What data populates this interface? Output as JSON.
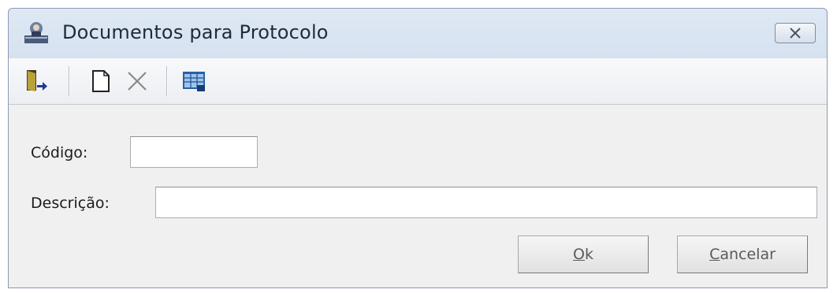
{
  "window": {
    "title": "Documentos para Protocolo",
    "close_icon": "close-icon"
  },
  "toolbar": {
    "items": [
      {
        "name": "exit",
        "icon": "exit-door-icon"
      },
      {
        "name": "new",
        "icon": "new-document-icon"
      },
      {
        "name": "delete",
        "icon": "delete-x-icon"
      },
      {
        "name": "view",
        "icon": "grid-view-icon"
      }
    ]
  },
  "form": {
    "codigo_label": "Código:",
    "codigo_value": "",
    "descricao_label": "Descrição:",
    "descricao_value": ""
  },
  "buttons": {
    "ok_mnemonic": "O",
    "ok_rest": "k",
    "cancel_mnemonic": "C",
    "cancel_rest": "ancelar"
  },
  "colors": {
    "title_bar": "#c9d8ea",
    "body": "#f0f0f0"
  }
}
